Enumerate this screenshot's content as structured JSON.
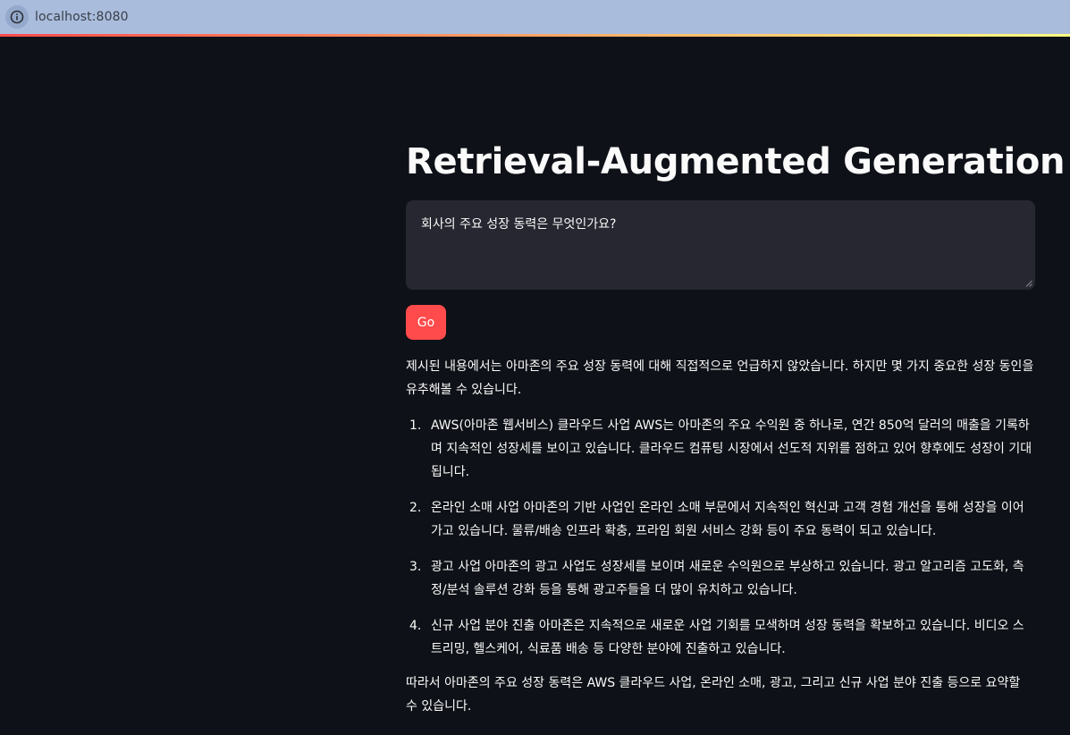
{
  "browser": {
    "url": "localhost:8080"
  },
  "page": {
    "title": "Retrieval-Augmented Generation"
  },
  "query": {
    "value": "회사의 주요 성장 동력은 무엇인가요?"
  },
  "actions": {
    "go_label": "Go"
  },
  "answer": {
    "intro": "제시된 내용에서는 아마존의 주요 성장 동력에 대해 직접적으로 언급하지 않았습니다. 하지만 몇 가지 중요한 성장 동인을 유추해볼 수 있습니다.",
    "items": [
      {
        "number": "1.",
        "text": "AWS(아마존 웹서비스) 클라우드 사업 AWS는 아마존의 주요 수익원 중 하나로, 연간 850억 달러의 매출을 기록하며 지속적인 성장세를 보이고 있습니다. 클라우드 컴퓨팅 시장에서 선도적 지위를 점하고 있어 향후에도 성장이 기대됩니다."
      },
      {
        "number": "2.",
        "text": "온라인 소매 사업 아마존의 기반 사업인 온라인 소매 부문에서 지속적인 혁신과 고객 경험 개선을 통해 성장을 이어가고 있습니다. 물류/배송 인프라 확충, 프라임 회원 서비스 강화 등이 주요 동력이 되고 있습니다."
      },
      {
        "number": "3.",
        "text": "광고 사업 아마존의 광고 사업도 성장세를 보이며 새로운 수익원으로 부상하고 있습니다. 광고 알고리즘 고도화, 측정/분석 솔루션 강화 등을 통해 광고주들을 더 많이 유치하고 있습니다."
      },
      {
        "number": "4.",
        "text": "신규 사업 분야 진출 아마존은 지속적으로 새로운 사업 기회를 모색하며 성장 동력을 확보하고 있습니다. 비디오 스트리밍, 헬스케어, 식료품 배송 등 다양한 분야에 진출하고 있습니다."
      }
    ],
    "outro": "따라서 아마존의 주요 성장 동력은 AWS 클라우드 사업, 온라인 소매, 광고, 그리고 신규 사업 분야 진출 등으로 요약할 수 있습니다."
  },
  "colors": {
    "background": "#0e1117",
    "input_background": "#262730",
    "primary": "#ff4b4b",
    "text": "#fafafa",
    "browser_bar": "#a9bcdc"
  },
  "icons": {
    "site_info": "info-icon",
    "resize": "resize-handle-icon"
  }
}
